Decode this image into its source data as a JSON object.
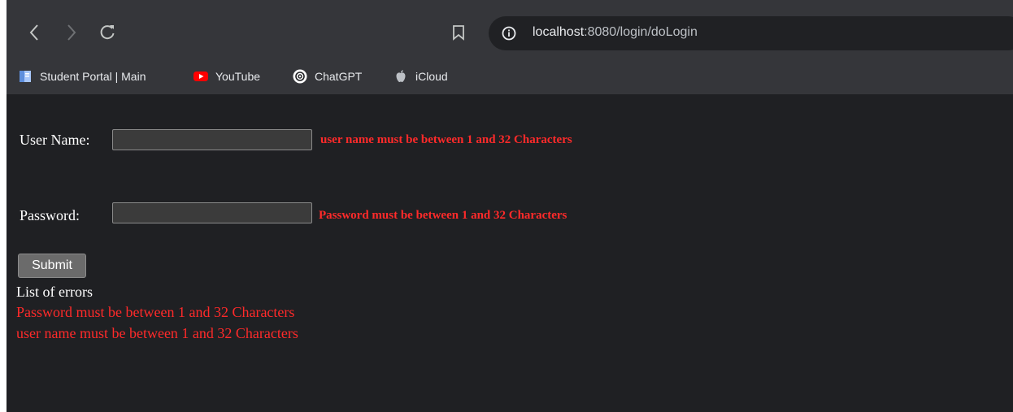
{
  "browser": {
    "url_host": "localhost",
    "url_rest": ":8080/login/doLogin"
  },
  "bookmarks": [
    {
      "label": "Student Portal | Main",
      "icon": "document-icon"
    },
    {
      "label": "YouTube",
      "icon": "youtube-icon"
    },
    {
      "label": "ChatGPT",
      "icon": "chatgpt-icon"
    },
    {
      "label": "iCloud",
      "icon": "apple-icon"
    }
  ],
  "form": {
    "username_label": "User Name:",
    "username_value": "",
    "username_error": "user name must be between 1 and 32 Characters",
    "password_label": "Password:",
    "password_value": "",
    "password_error": "Password must be between 1 and 32 Characters",
    "submit_label": "Submit"
  },
  "errors": {
    "title": "List of errors",
    "items": [
      "Password must be between 1 and 32 Characters",
      "user name must be between 1 and 32 Characters"
    ]
  },
  "colors": {
    "error": "#ff2a2a",
    "background": "#1f2023",
    "toolbar": "#35363a"
  }
}
